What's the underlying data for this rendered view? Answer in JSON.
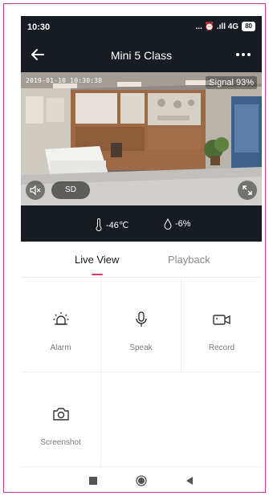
{
  "status_bar": {
    "time": "10:30",
    "icons_text": "... ⏰ .ıll 4G",
    "battery": "80"
  },
  "header": {
    "title": "Mini 5 Class"
  },
  "video": {
    "timestamp": "2019-01-10 10:30:38",
    "signal": "Signal 93%",
    "quality": "SD"
  },
  "readings": {
    "temperature": "-46℃",
    "humidity": "-6%"
  },
  "tabs": [
    {
      "label": "Live View",
      "active": true
    },
    {
      "label": "Playback",
      "active": false
    }
  ],
  "functions": [
    {
      "label": "Alarm",
      "icon": "alarm-icon"
    },
    {
      "label": "Speak",
      "icon": "microphone-icon"
    },
    {
      "label": "Record",
      "icon": "video-record-icon"
    },
    {
      "label": "Screenshot",
      "icon": "camera-icon"
    }
  ],
  "colors": {
    "accent": "#e8336d",
    "dark_bg": "#171b22",
    "frame": "#c23ca6"
  }
}
